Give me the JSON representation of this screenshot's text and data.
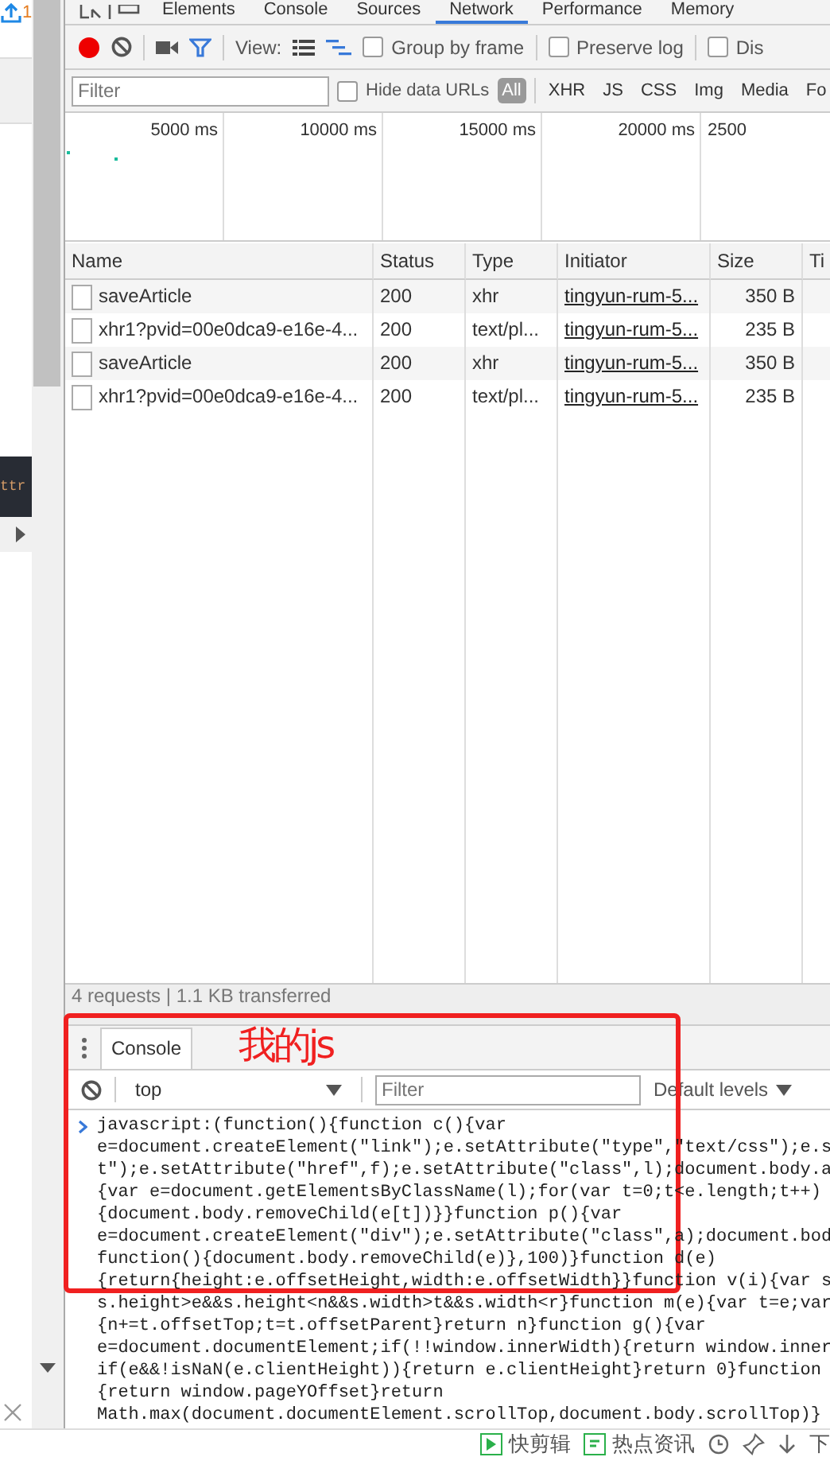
{
  "page_behind": {
    "badge": "1",
    "snippet": "ttr"
  },
  "tabs": [
    {
      "label": "Elements",
      "selected": false
    },
    {
      "label": "Console",
      "selected": false
    },
    {
      "label": "Sources",
      "selected": false
    },
    {
      "label": "Network",
      "selected": true
    },
    {
      "label": "Performance",
      "selected": false
    },
    {
      "label": "Memory",
      "selected": false
    }
  ],
  "toolbar": {
    "view_label": "View:",
    "options": [
      {
        "label": "Group by frame",
        "checked": false
      },
      {
        "label": "Preserve log",
        "checked": false
      },
      {
        "label": "Dis",
        "checked": false
      }
    ]
  },
  "filter_bar": {
    "placeholder": "Filter",
    "hide_data_urls": {
      "label": "Hide data URLs",
      "checked": false
    },
    "types": [
      {
        "label": "All",
        "selected": true
      },
      {
        "label": "XHR",
        "selected": false
      },
      {
        "label": "JS",
        "selected": false
      },
      {
        "label": "CSS",
        "selected": false
      },
      {
        "label": "Img",
        "selected": false
      },
      {
        "label": "Media",
        "selected": false
      },
      {
        "label": "Fo",
        "selected": false
      }
    ]
  },
  "overview": {
    "ticks": [
      "5000 ms",
      "10000 ms",
      "15000 ms",
      "20000 ms",
      "2500"
    ]
  },
  "table": {
    "columns": [
      "Name",
      "Status",
      "Type",
      "Initiator",
      "Size",
      "Ti"
    ],
    "rows": [
      {
        "name": "saveArticle",
        "status": "200",
        "type": "xhr",
        "initiator": "tingyun-rum-5...",
        "size": "350 B"
      },
      {
        "name": "xhr1?pvid=00e0dca9-e16e-4...",
        "status": "200",
        "type": "text/pl...",
        "initiator": "tingyun-rum-5...",
        "size": "235 B"
      },
      {
        "name": "saveArticle",
        "status": "200",
        "type": "xhr",
        "initiator": "tingyun-rum-5...",
        "size": "350 B"
      },
      {
        "name": "xhr1?pvid=00e0dca9-e16e-4...",
        "status": "200",
        "type": "text/pl...",
        "initiator": "tingyun-rum-5...",
        "size": "235 B"
      }
    ]
  },
  "status_bar": "4 requests | 1.1 KB transferred",
  "drawer": {
    "tabs": [
      {
        "label": "Console",
        "selected": true
      }
    ],
    "context": "top",
    "placeholder": "Filter",
    "levels": "Default levels",
    "code_lines": [
      "javascript:(function(){function c(){var",
      "e=document.createElement(\"link\");e.setAttribute(\"type\",\"text/css\");e.s",
      "t\");e.setAttribute(\"href\",f);e.setAttribute(\"class\",l);document.body.a",
      "{var e=document.getElementsByClassName(l);for(var t=0;t<e.length;t++)",
      "{document.body.removeChild(e[t])}}function p(){var",
      "e=document.createElement(\"div\");e.setAttribute(\"class\",a);document.bod",
      "function(){document.body.removeChild(e)},100)}function d(e)",
      "{return{height:e.offsetHeight,width:e.offsetWidth}}function v(i){var s",
      "s.height>e&&s.height<n&&s.width>t&&s.width<r}function m(e){var t=e;var",
      "{n+=t.offsetTop;t=t.offsetParent}return n}function g(){var",
      "e=document.documentElement;if(!!window.innerWidth){return window.inner",
      "if(e&&!isNaN(e.clientHeight)){return e.clientHeight}return 0}function",
      "{return window.pageYOffset}return",
      "Math.max(document.documentElement.scrollTop,document.body.scrollTop)}"
    ]
  },
  "annotation": {
    "text": "我的js"
  },
  "taskbar": {
    "items": [
      "快剪辑",
      "热点资讯"
    ],
    "cut_label": "下"
  }
}
